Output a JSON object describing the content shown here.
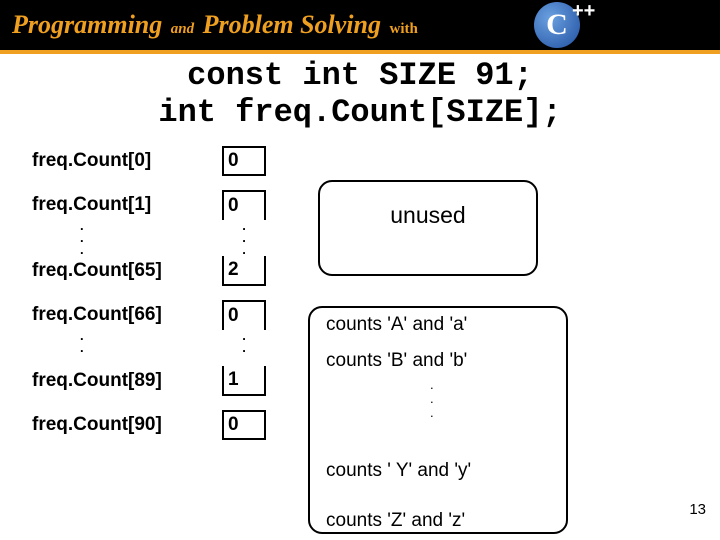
{
  "header": {
    "word1": "Programming",
    "and": "and",
    "word2": "Problem Solving",
    "with": "with",
    "lang": "C",
    "plus": "++"
  },
  "title_line1": "const int SIZE 91;",
  "title_line2": "int freq.Count[SIZE];",
  "labels": {
    "r0": "freq.Count[0]",
    "r1": "freq.Count[1]",
    "r65": "freq.Count[65]",
    "r66": "freq.Count[66]",
    "r89": "freq.Count[89]",
    "r90": "freq.Count[90]"
  },
  "values": {
    "r0": "0",
    "r1": "0",
    "r65": "2",
    "r66": "0",
    "r89": "1",
    "r90": "0"
  },
  "annotations": {
    "unused": "unused",
    "a65": "counts  'A'  and  'a'",
    "a66": "counts  'B'  and  'b'",
    "a89": "counts  ' Y'  and  'y'",
    "a90": "counts  'Z'  and  'z'"
  },
  "page_number": "13",
  "chart_data": {
    "type": "table",
    "title": "const int SIZE 91; int freq.Count[SIZE];",
    "columns": [
      "index_label",
      "value",
      "annotation"
    ],
    "rows": [
      {
        "index_label": "freq.Count[0]",
        "value": 0,
        "annotation": "unused"
      },
      {
        "index_label": "freq.Count[1]",
        "value": 0,
        "annotation": "unused"
      },
      {
        "index_label": "freq.Count[65]",
        "value": 2,
        "annotation": "counts 'A' and 'a'"
      },
      {
        "index_label": "freq.Count[66]",
        "value": 0,
        "annotation": "counts 'B' and 'b'"
      },
      {
        "index_label": "freq.Count[89]",
        "value": 1,
        "annotation": "counts 'Y' and 'y'"
      },
      {
        "index_label": "freq.Count[90]",
        "value": 0,
        "annotation": "counts 'Z' and 'z'"
      }
    ]
  }
}
